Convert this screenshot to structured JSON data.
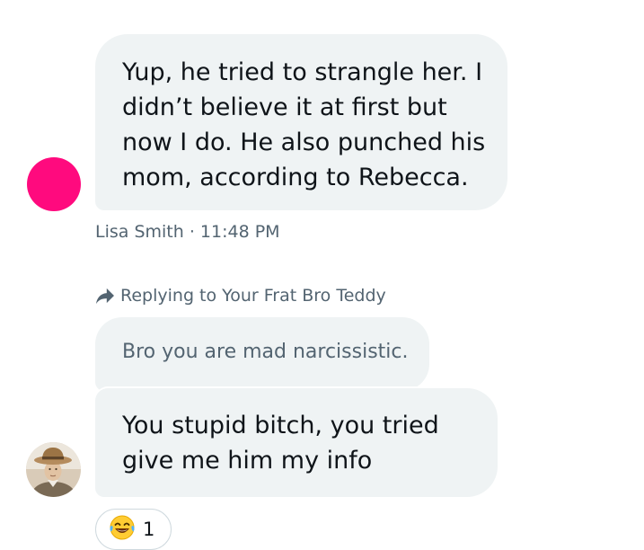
{
  "messages": [
    {
      "text": "Yup, he tried to strangle her. I didn’t believe it at first but now I do. He also punched his mom, according to Rebecca."
    },
    {
      "text": "You stupid bitch, you tried give me him my info"
    }
  ],
  "meta": {
    "text": "Lisa Smith · 11:48 PM"
  },
  "reply": {
    "label": "Replying to Your Frat Bro Teddy",
    "quoted_text": "Bro you are mad narcissistic."
  },
  "reaction": {
    "emoji": "laughing-with-tears-icon",
    "count": "1"
  },
  "colors": {
    "bubble_bg": "#eff3f4",
    "text": "#0f1419",
    "secondary_text": "#536471",
    "avatar_pink": "#ff0a7e",
    "border": "#cfd9de"
  }
}
